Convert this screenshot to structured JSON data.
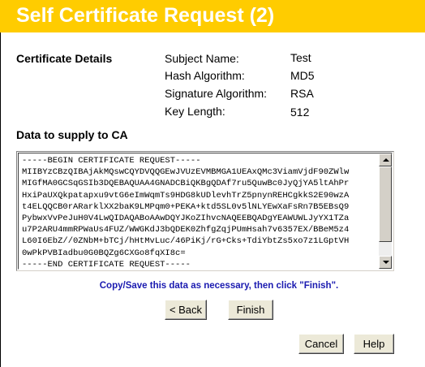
{
  "page": {
    "title": "Self Certificate Request (2)",
    "title_bg": "#ffcc00",
    "title_color": "#ffffff"
  },
  "certificate_details": {
    "label": "Certificate Details",
    "fields": [
      {
        "key": "Subject Name:",
        "value": "Test"
      },
      {
        "key": "Hash Algorithm:",
        "value": "MD5"
      },
      {
        "key": "Signature Algorithm:",
        "value": "RSA"
      },
      {
        "key": "Key Length:",
        "value": "512"
      }
    ]
  },
  "ca_data": {
    "label": "Data to supply to CA",
    "text": "-----BEGIN CERTIFICATE REQUEST-----\nMIIBYzCBzQIBAjAkMQswCQYDVQQGEwJVUzEVMBMGA1UEAxQMc3ViamVjdF90ZWlw\nMIGfMA0GCSqGSIb3DQEBAQUAA4GNADCBiQKBgQDAf7ru5QuwBc0JyQjYA5ltAhPr\nHxiPaUXQkpatapxu9vtG6eImWqmTs9HDG8kUDlevhTrZ5pnynREHCgkkS2E90wzA\nt4ELQQCB0rARarklXX2baK9LMPqm0+PEKA+ktd5SL0v5lNLYEwXaFsRn7B5EBsQ9\nPybwxVvPeJuH0V4LwQIDAQABoAAwDQYJKoZIhvcNAQEEBQADgYEAWUWLJyYX1TZa\nu7P2ARU4mmRPWaUs4FUZ/WWGKdJ3bQDEK0ZhfgZqjPUmHsah7v6357EX/BBeM5z4\nL60I6EbZ//0ZNbM+bTCj/hHtMvLuc/46PiKj/rG+Cks+TdiYbtZs5xo7z1LGptVH\n0wPkPVBIadbu0G0BQZg6CXGo8fqXI8c=\n-----END CERTIFICATE REQUEST-----",
    "hint": "Copy/Save this data as necessary, then click \"Finish\".",
    "hint_color": "#1a1ab0"
  },
  "buttons": {
    "back": "< Back",
    "finish": "Finish",
    "cancel": "Cancel",
    "help": "Help"
  }
}
